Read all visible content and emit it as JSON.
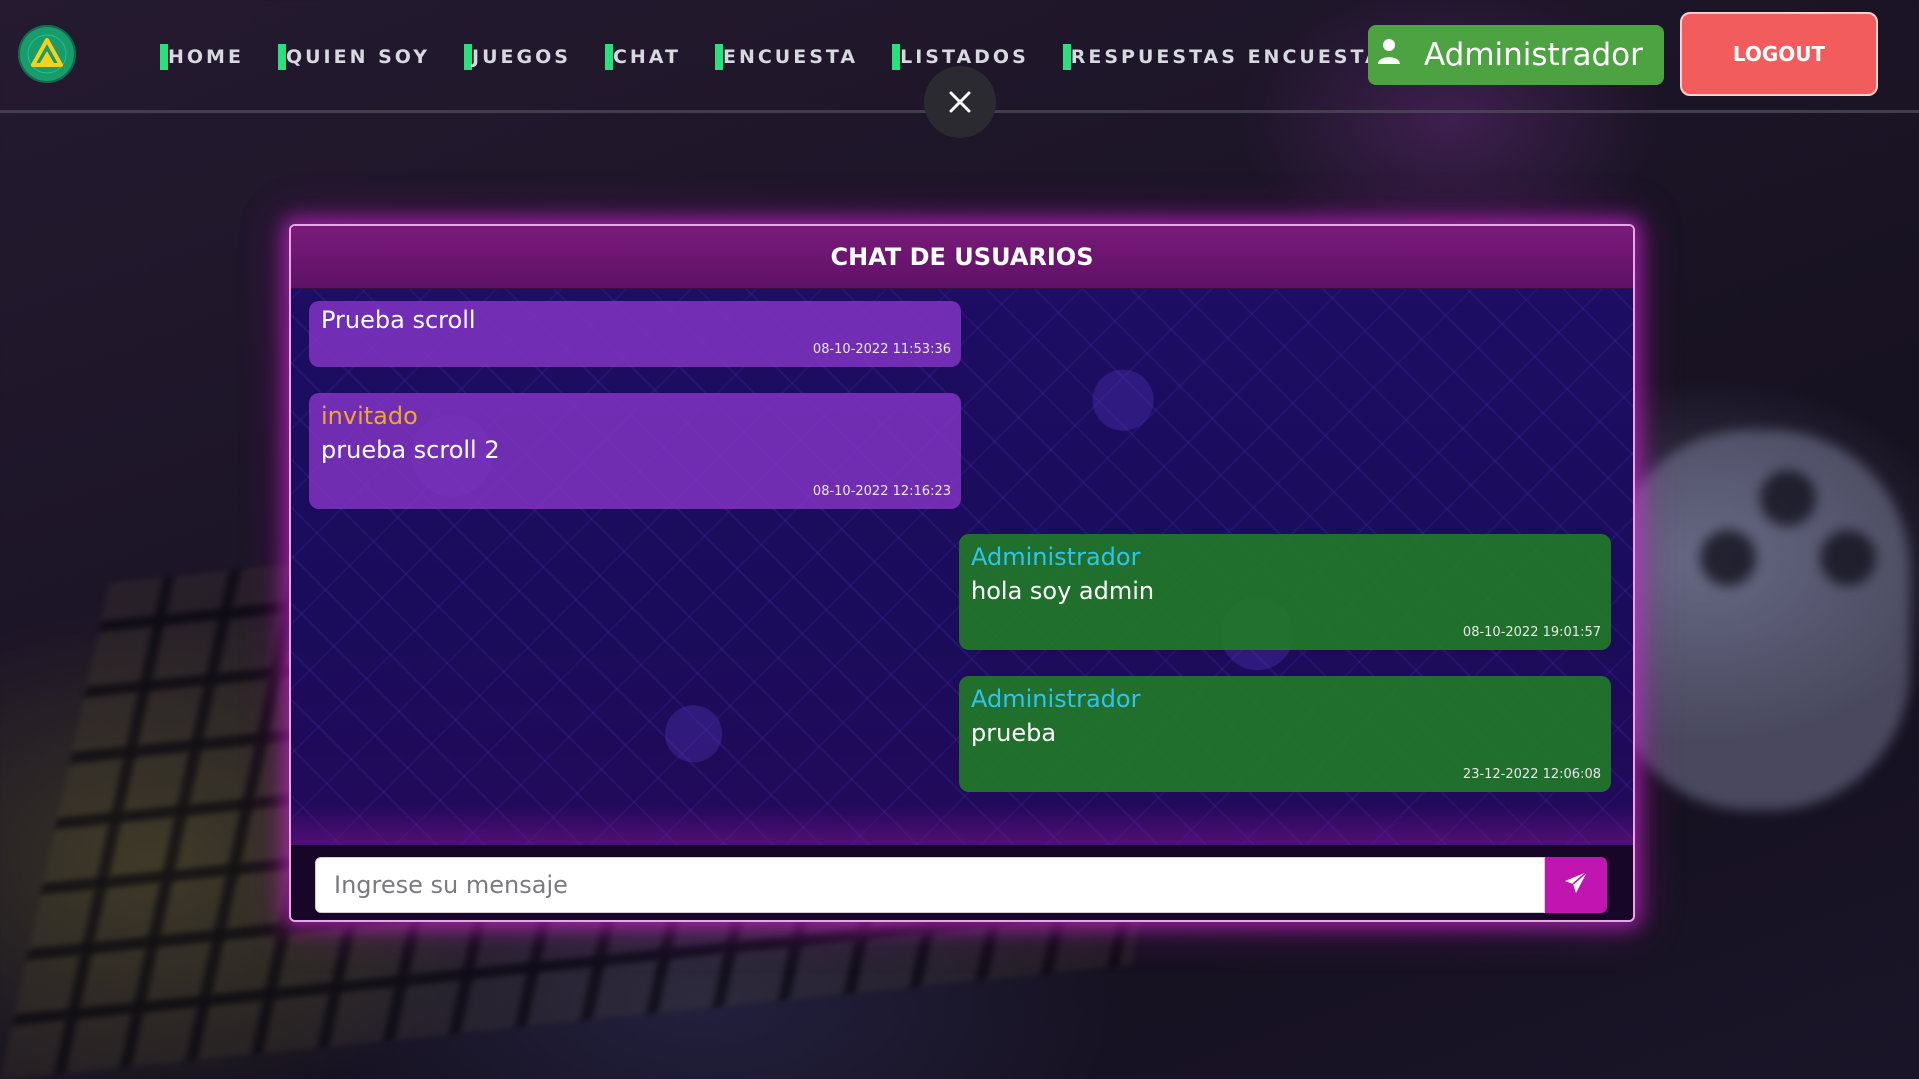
{
  "navbar": {
    "logo_icon": "triangle-logo-icon",
    "links": [
      {
        "label": "HOME"
      },
      {
        "label": "QUIEN SOY"
      },
      {
        "label": "JUEGOS"
      },
      {
        "label": "CHAT"
      },
      {
        "label": "ENCUESTA"
      },
      {
        "label": "LISTADOS"
      },
      {
        "label": "RESPUESTAS ENCUESTA"
      }
    ],
    "user_label": "Administrador",
    "logout_label": "LOGOUT",
    "accent_color": "#28e07e"
  },
  "chat": {
    "title": "CHAT DE USUARIOS",
    "messages": [
      {
        "author": "",
        "text": "Prueba scroll",
        "time": "08-10-2022 11:53:36",
        "side": "left"
      },
      {
        "author": "invitado",
        "text": "prueba scroll 2",
        "time": "08-10-2022 12:16:23",
        "side": "left"
      },
      {
        "author": "Administrador",
        "text": "hola soy admin",
        "time": "08-10-2022 19:01:57",
        "side": "right"
      },
      {
        "author": "Administrador",
        "text": "prueba",
        "time": "23-12-2022 12:06:08",
        "side": "right"
      }
    ],
    "input_placeholder": "Ingrese su mensaje",
    "input_value": "",
    "send_icon": "paper-plane-icon"
  },
  "colors": {
    "guest_bubble": "#7d32be",
    "admin_bubble": "#227828",
    "guest_name": "#f0a82c",
    "admin_name": "#2ec4ee",
    "logout": "#f35c5c",
    "user_button": "#4da341",
    "send_button": "#c015b0"
  }
}
